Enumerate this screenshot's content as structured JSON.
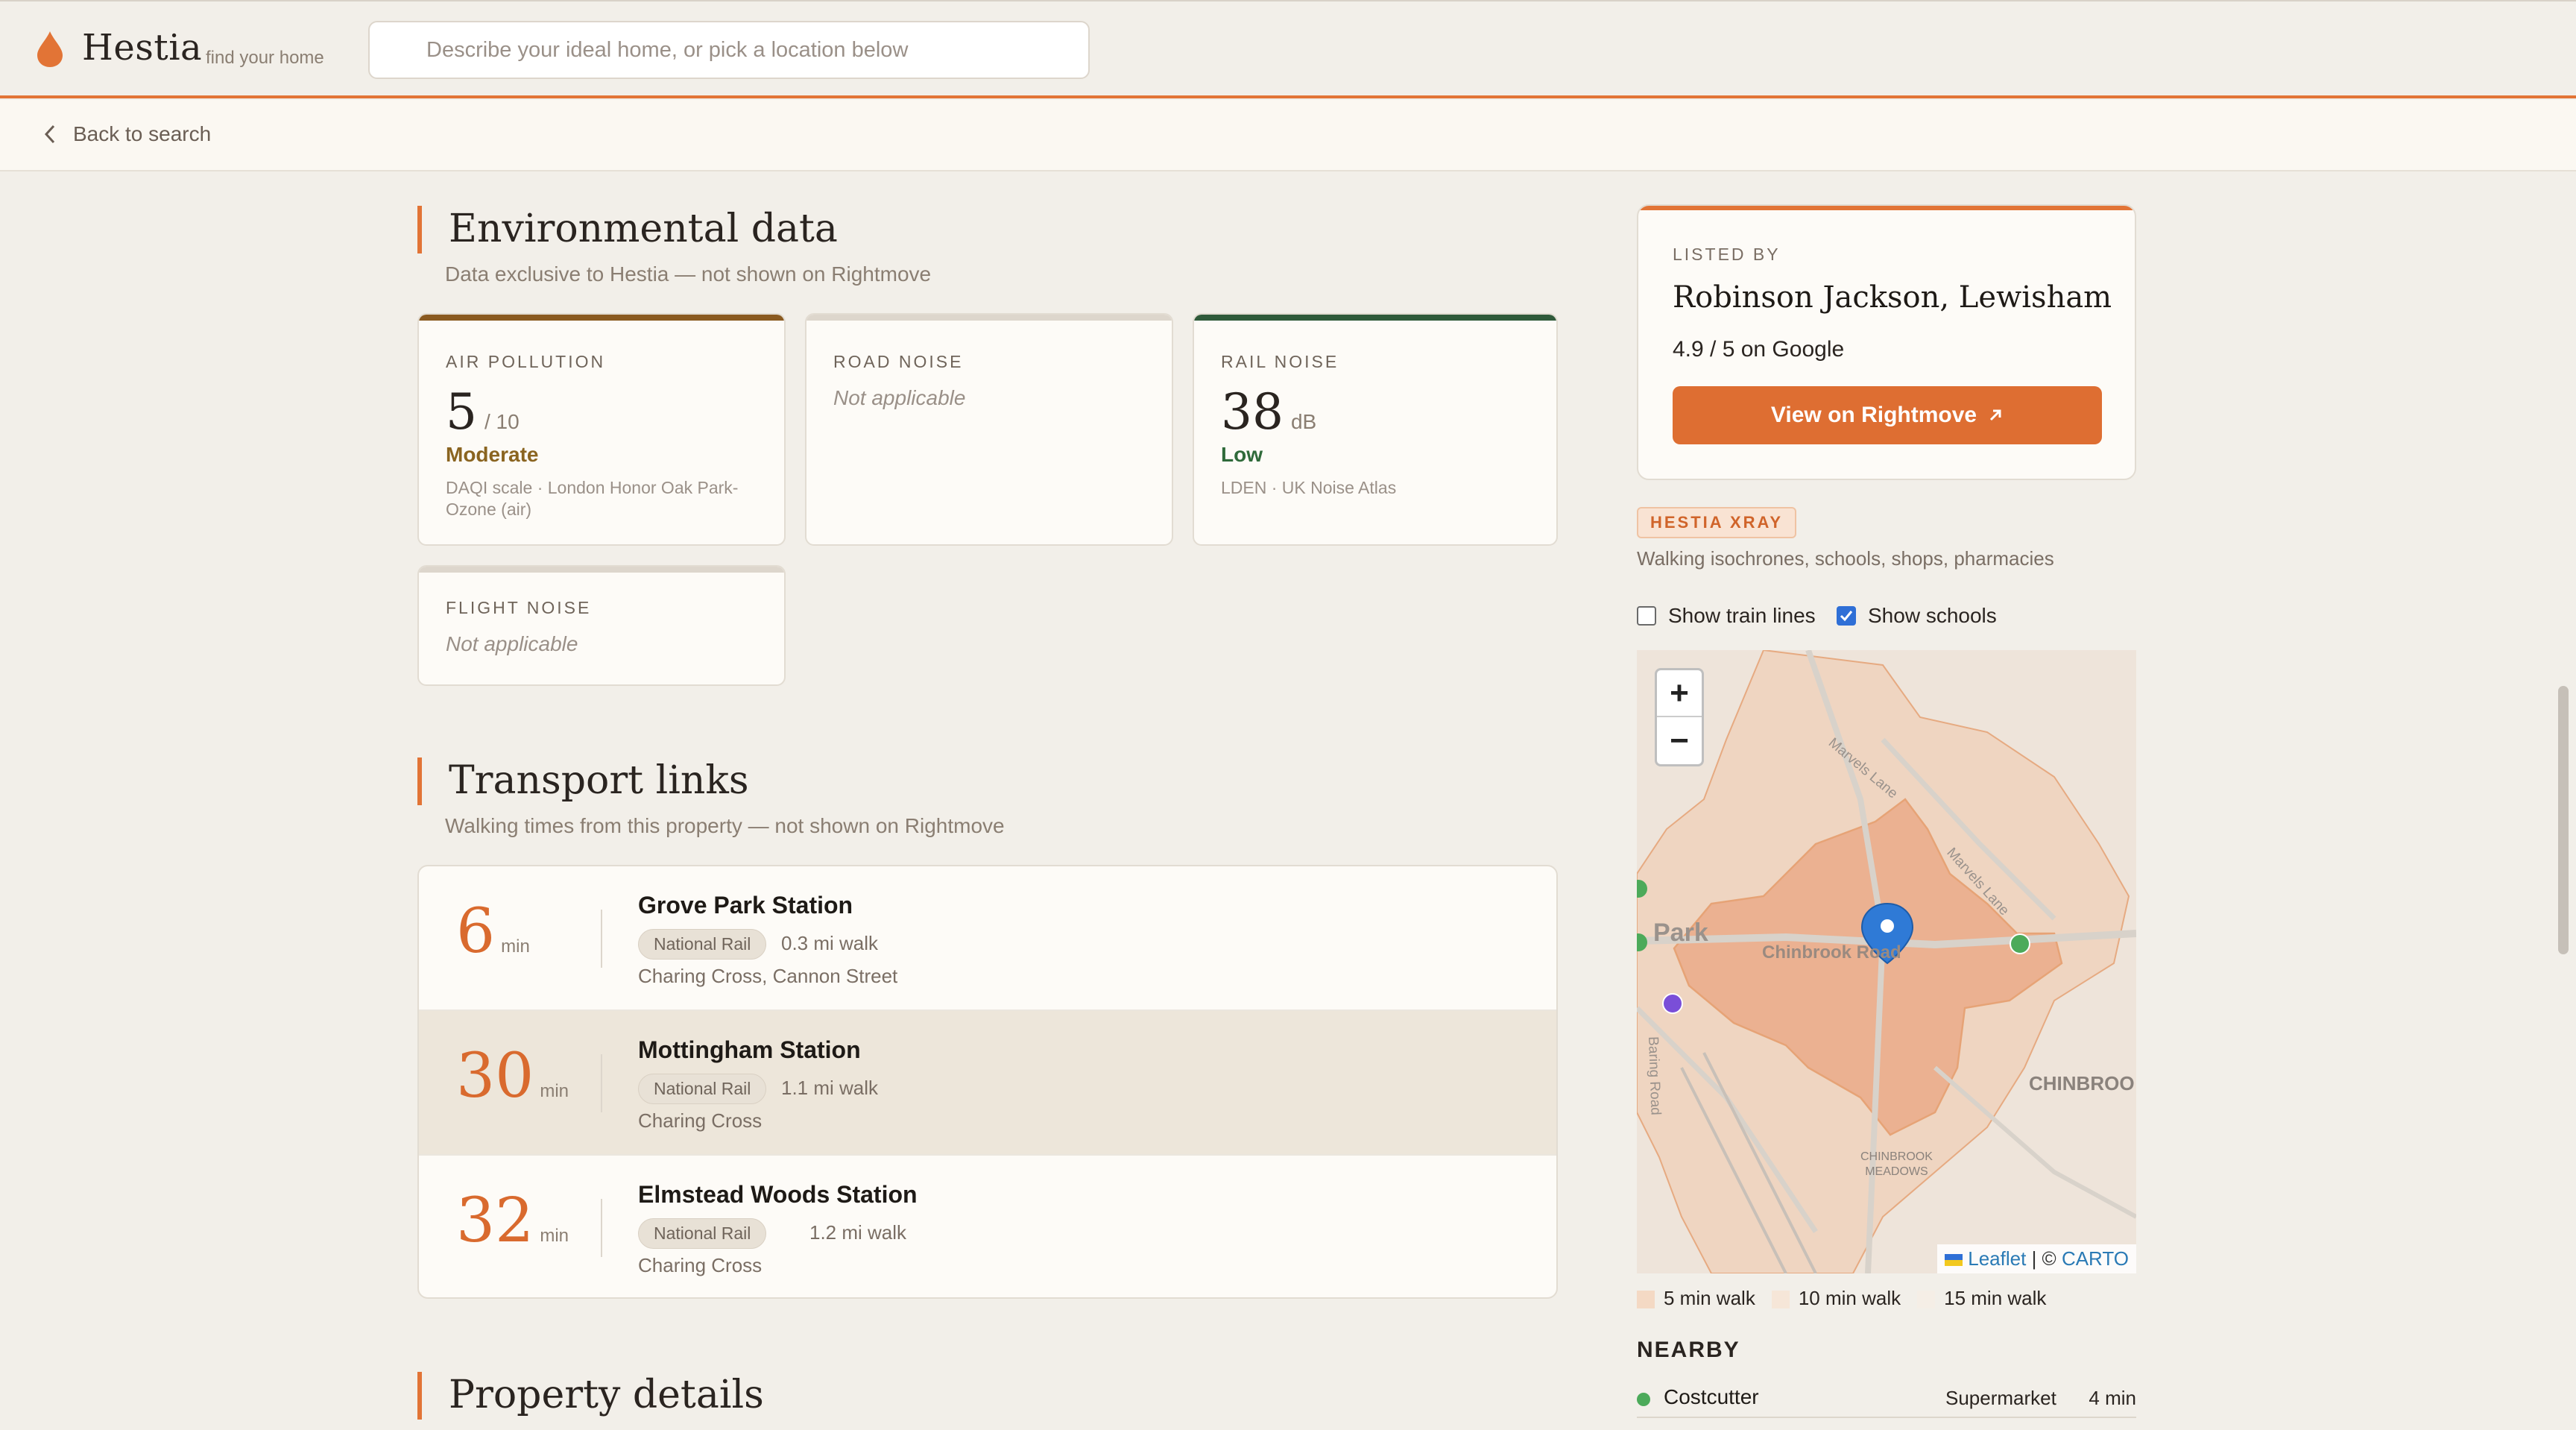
{
  "header": {
    "brand": "Hestia",
    "tagline": "find your home",
    "search_placeholder": "Describe your ideal home, or pick a location below",
    "back_label": "Back to search"
  },
  "environmental": {
    "title": "Environmental data",
    "subtitle": "Data exclusive to Hestia — not shown on Rightmove",
    "air": {
      "label": "AIR POLLUTION",
      "value": "5",
      "unit": "/ 10",
      "level": "Moderate",
      "source": "DAQI scale · London Honor Oak Park-Ozone (air)"
    },
    "road": {
      "label": "ROAD NOISE",
      "status": "Not applicable"
    },
    "rail": {
      "label": "RAIL NOISE",
      "value": "38",
      "unit": "dB",
      "level": "Low",
      "source": "LDEN · UK Noise Atlas"
    },
    "flight": {
      "label": "FLIGHT NOISE",
      "status": "Not applicable"
    },
    "colors": {
      "moderate": "#8a6420",
      "low": "#2f6a3a"
    }
  },
  "transport": {
    "title": "Transport links",
    "subtitle": "Walking times from this property — not shown on Rightmove",
    "unit": "min",
    "stations": [
      {
        "minutes": "6",
        "name": "Grove Park Station",
        "type": "National Rail",
        "distance": "0.3 mi walk",
        "destinations": "Charing Cross, Cannon Street"
      },
      {
        "minutes": "30",
        "name": "Mottingham Station",
        "type": "National Rail",
        "distance": "1.1 mi walk",
        "destinations": "Charing Cross"
      },
      {
        "minutes": "32",
        "name": "Elmstead Woods Station",
        "type": "National Rail",
        "distance": "1.2 mi walk",
        "destinations": "Charing Cross"
      }
    ]
  },
  "property_details": {
    "title": "Property details"
  },
  "listing": {
    "listed_by_label": "LISTED BY",
    "agent": "Robinson Jackson, Lewisham",
    "rating": "4.9 / 5 on Google",
    "button": "View on Rightmove"
  },
  "xray": {
    "badge": "HESTIA XRAY",
    "subtitle": "Walking isochrones, schools, shops, pharmacies",
    "toggle_train": "Show train lines",
    "toggle_schools": "Show schools",
    "train_checked": false,
    "schools_checked": true
  },
  "map": {
    "labels": {
      "road1": "Chinbrook Road",
      "road2": "Marvels Lane",
      "road3": "Marvels Lane",
      "road4": "Baring Road",
      "area1": "Park",
      "area2": "CHINBROO",
      "meadows1": "CHINBROOK",
      "meadows2": "MEADOWS"
    },
    "zoom_in": "+",
    "zoom_out": "−",
    "attribution_leaflet": "Leaflet",
    "attribution_sep": "| ©",
    "attribution_carto": "CARTO",
    "isochrone_color": "#e8824a"
  },
  "legend": [
    {
      "label": "5 min walk",
      "color": "#f4d9c4"
    },
    {
      "label": "10 min walk",
      "color": "#f6e6d8"
    },
    {
      "label": "15 min walk",
      "color": "#f5eee6"
    }
  ],
  "nearby": {
    "title": "NEARBY",
    "items": [
      {
        "name": "Costcutter",
        "category": "Supermarket",
        "time": "4 min"
      }
    ]
  }
}
